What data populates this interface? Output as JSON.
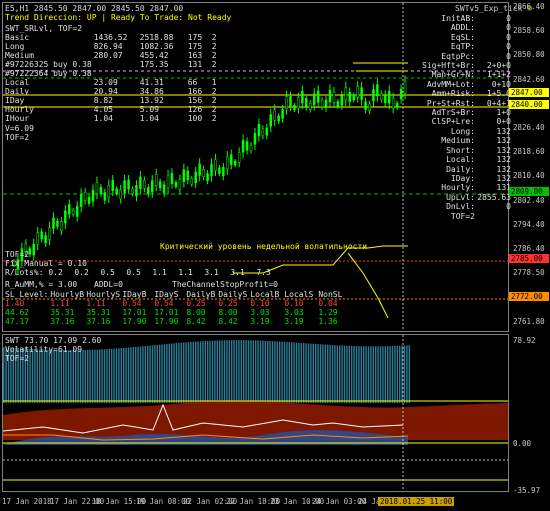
{
  "header": {
    "symbol_line": "E5,H1  2845.50 2847.00 2845.50 2847.00",
    "trend_line": "Trend Direccion:  UP  |  Ready To Trade:  Not Ready",
    "ea_name": "SWTv5_Exp_tick",
    "smile_icon": "smile-icon"
  },
  "left_panel": {
    "title": "SWT_SRLvl, TOF=2",
    "rows": [
      [
        "Basic",
        "1436.52",
        "2518.88",
        "175",
        "2"
      ],
      [
        "Long",
        "826.94",
        "1082.36",
        "175",
        "2"
      ],
      [
        "Medium",
        "280.07",
        "455.42",
        "163",
        "2"
      ],
      [
        "#97226325 buy 0.38",
        "",
        "175.35",
        "131",
        "2"
      ],
      [
        "#97222364 buy 0.38",
        "",
        "",
        "",
        ""
      ],
      [
        "Local",
        "23.09",
        "41.31",
        "66",
        "1"
      ],
      [
        "Daily",
        "20.94",
        "34.86",
        "166",
        "2"
      ],
      [
        "IDay",
        "8.82",
        "13.92",
        "156",
        "2"
      ],
      [
        "Hourly",
        "4.05",
        "5.09",
        "126",
        "2"
      ],
      [
        "IHour",
        "1.04",
        "1.04",
        "100",
        "2"
      ]
    ],
    "v_line": "V=6.09",
    "tof_line": "TOF=2"
  },
  "right_panel": {
    "rows": [
      [
        "InitAB:",
        "0"
      ],
      [
        "ADDL:",
        "0"
      ],
      [
        "EqSL:",
        "0"
      ],
      [
        "EqTP:",
        "0"
      ],
      [
        "EqtpPc:",
        "0"
      ],
      [
        "Sig+Hft+Br:",
        "2+0+0"
      ],
      [
        "Man+Gr+N:",
        "1+1+2"
      ],
      [
        "AdvMM+Lot:",
        "0+10"
      ],
      [
        "Amm+Risk:",
        "1+5.0"
      ],
      [
        "Pr+St+Rst:",
        "0+4+1"
      ],
      [
        "AdTrS+Br:",
        "1+0"
      ],
      [
        "ClSP+Lre:",
        "0+0"
      ],
      [
        "Long:",
        "132"
      ],
      [
        "Medium:",
        "132"
      ],
      [
        "Short:",
        "132"
      ],
      [
        "Local:",
        "132"
      ],
      [
        "Daily:",
        "132"
      ],
      [
        "IDay:",
        "132"
      ],
      [
        "Hourly:",
        "131"
      ],
      [
        "UpLvl:",
        "2855.63"
      ],
      [
        "DnLvl:",
        "0"
      ],
      [
        "TOF=2",
        ""
      ]
    ]
  },
  "bottom_panel": {
    "tof": "TOF=2",
    "fix_manual": "Fix_Manual = 0.10",
    "rlots_label": "R/Lots%:",
    "rlots_values": [
      "0.2",
      "0.2",
      "0.5",
      "0.5",
      "1.1",
      "1.1",
      "3.1",
      "3.1",
      "7.3"
    ],
    "r_aumm": "R_AuMM,% = 3.00",
    "addl": "ADDL=0",
    "channel": "TheChannelStopProfit=0",
    "sl_headers": [
      "SL_Level:",
      "HourlyB",
      "HourlyS",
      "IDayB",
      "IDayS",
      "DailyB",
      "DailyS",
      "LocalB",
      "LocalS",
      "NonSL"
    ],
    "sl_rows": [
      [
        "1.40",
        "1.11",
        "1.11",
        "0.54",
        "0.54",
        "0.25",
        "0.25",
        "0.10",
        "0.10",
        "0.04"
      ],
      [
        "44.62",
        "35.31",
        "35.31",
        "17.01",
        "17.01",
        "8.00",
        "8.00",
        "3.03",
        "3.03",
        "1.29"
      ],
      [
        "47.17",
        "37.16",
        "37.16",
        "17.90",
        "17.90",
        "8.42",
        "8.42",
        "3.19",
        "3.19",
        "1.36"
      ]
    ],
    "order_tag": "#97222384 b"
  },
  "annotation": "Критический уровень недельной волатильности",
  "y_axis": {
    "labels": [
      "2866.40",
      "2858.60",
      "2850.80",
      "2842.60",
      "2834.60",
      "2826.40",
      "2818.60",
      "2810.40",
      "2802.40",
      "2794.40",
      "2786.40",
      "2778.50",
      "2770.40",
      "2761.80"
    ],
    "boxes": [
      {
        "text": "2847.00",
        "color": "#ffff00",
        "fg": "#000"
      },
      {
        "text": "2840.00",
        "color": "#ffff00",
        "fg": "#000"
      },
      {
        "text": "2809.00",
        "color": "#00c000",
        "fg": "#000"
      },
      {
        "text": "2785.00",
        "color": "#ff3030",
        "fg": "#000"
      },
      {
        "text": "2772.00",
        "color": "#ff8c00",
        "fg": "#000"
      }
    ]
  },
  "sub_window": {
    "title": "SWT 73.70 17.09 2.60",
    "volatility": "Volatility=61.09",
    "tof": "TOF=2",
    "y_labels": [
      "78.92",
      "0.00",
      "-35.97"
    ]
  },
  "x_axis": {
    "labels": [
      "17 Jan 2018",
      "17 Jan 22:00",
      "18 Jan 15:00",
      "19 Jan 08:00",
      "22 Jan 02:00",
      "22 Jan 18:00",
      "23 Jan 10:00",
      "24 Jan 03:00",
      "24 Jan 20:00"
    ],
    "highlight": "2018.01.25 11:00"
  },
  "colors": {
    "candle": "#00ff00",
    "level": "#ffff00",
    "annotation": "#ffff00",
    "red_level": "#ff3030",
    "band_fill": "#2a6f8a",
    "band_red": "#8b1a00"
  }
}
